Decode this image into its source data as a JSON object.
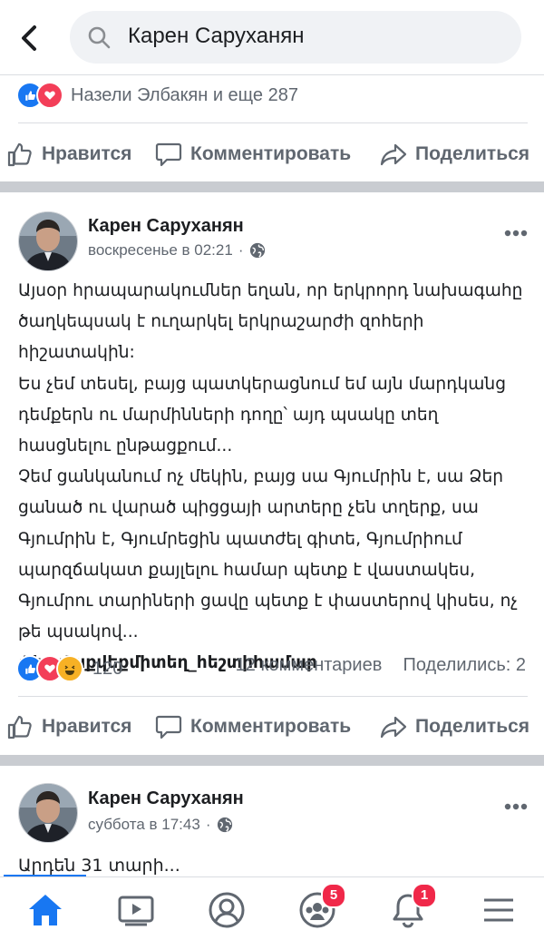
{
  "header": {
    "search_value": "Карен Саруханян"
  },
  "post1_tail": {
    "reactions_text": "Назели Элбакян и еще 287",
    "actions": {
      "like": "Нравится",
      "comment": "Комментировать",
      "share": "Поделиться"
    }
  },
  "post2": {
    "author": "Карен Саруханян",
    "time": "воскресенье в 02:21",
    "paragraphs": [
      "Այսօր հրապարակումներ եղան, որ երկրորդ նախագահը ծաղկեպսակ է ուղարկել երկրաշարժի զոհերի հիշատակին:",
      "Ես չեմ տեսել, բայց պատկերացնում եմ այն մարդկանց դեմքերն ու մարմինների դողը՝ այդ պսակը տեղ հասցնելու ընթացքում...",
      "Չեմ ցանկանում ոչ մեկին, բայց սա Գյումրին է, սա Ձեր ցանած ու վարած պիցցայի արտերը չեն տղերք, սա Գյումրին է, Գյումրեցին պատժել գիտե, Գյումրիում պարզճակատ քայլելու համար պետք է վաստակես, Գյումրու տարիների ցավը պետք է փաստերով կիսես, ոչ թե պսակով..."
    ],
    "hashtag": "#հավաքվեքմիտեղ_հեշտիհամար",
    "reactions_count": "120",
    "comments": "12 комментариев",
    "shares": "Поделились: 2",
    "actions": {
      "like": "Нравится",
      "comment": "Комментировать",
      "share": "Поделиться"
    }
  },
  "post3": {
    "author": "Карен Саруханян",
    "time": "суббота в 17:43",
    "snippet_link": "Արդեն",
    "snippet_rest": " 31 տարի..."
  },
  "meta_separator": "·",
  "bottom_nav": {
    "groups_badge": "5",
    "notifications_badge": "1"
  },
  "colors": {
    "accent": "#1877f2",
    "badge": "#f02849",
    "divider": "#c9ccd1"
  },
  "icons": [
    "back-arrow-icon",
    "search-icon",
    "like-icon",
    "love-icon",
    "haha-icon",
    "comment-icon",
    "share-icon",
    "globe-icon",
    "more-icon",
    "home-icon",
    "video-icon",
    "profile-icon",
    "groups-icon",
    "bell-icon",
    "menu-icon"
  ]
}
